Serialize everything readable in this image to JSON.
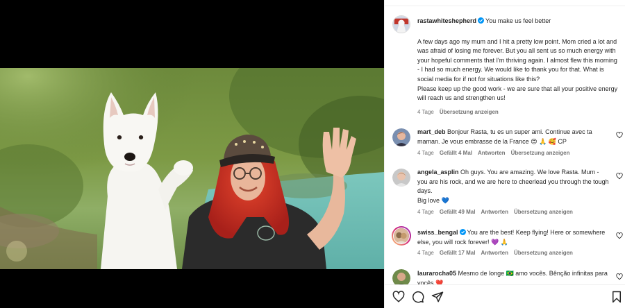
{
  "post": {
    "username": "rastawhiteshepherd",
    "headline": "You make us feel better",
    "caption": "A few days ago my mum and I hit a pretty low point. Mom cried a lot and was afraid of losing me forever. But you all sent us so much energy with your hopeful comments that I'm thriving again. I almost flew this morning - I had so much energy. We would like to thank you for that. What is social media for if not for situations like this?\nPlease keep up the good work - we are sure that all your positive energy will reach us and strengthen us!",
    "time": "4 Tage",
    "translate": "Übersetzung anzeigen"
  },
  "comments": [
    {
      "username": "mart_deb",
      "text": "Bonjour Rasta, tu es un super ami. Continue avec ta maman. Je vous embrasse de la France 😍 🙏 🥰 CP",
      "time": "4 Tage",
      "likes": "Gefällt 4 Mal",
      "reply": "Antworten",
      "translate": "Übersetzung anzeigen",
      "verified": false
    },
    {
      "username": "angela_asplin",
      "text": "Oh guys. You are amazing. We love Rasta. Mum - you are his rock, and we are here to cheerlead you through the tough days.\nBig love 💙",
      "time": "4 Tage",
      "likes": "Gefällt 49 Mal",
      "reply": "Antworten",
      "translate": "Übersetzung anzeigen",
      "verified": false
    },
    {
      "username": "swiss_bengal",
      "text": "You are the best! Keep flying! Here or somewhere else, you will rock forever! 💜 🙏",
      "time": "4 Tage",
      "likes": "Gefällt 17 Mal",
      "reply": "Antworten",
      "translate": "Übersetzung anzeigen",
      "verified": true
    },
    {
      "username": "laurarocha05",
      "text": "Mesmo de longe 🇧🇷 amo vocês. Bênção infinitas para vocês ❤️",
      "time": "",
      "likes": "",
      "reply": "",
      "translate": "",
      "verified": false
    }
  ],
  "icons": {
    "like": "heart-outline-icon",
    "comment": "comment-bubble-icon",
    "share": "paper-plane-icon",
    "save": "bookmark-icon",
    "verified": "verified-badge-icon"
  },
  "colors": {
    "verified": "#0095f6",
    "text": "#262626",
    "muted": "#737373",
    "border": "#efefef"
  }
}
